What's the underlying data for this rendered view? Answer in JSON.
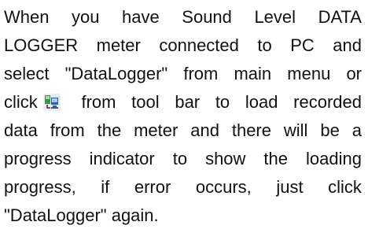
{
  "paragraph": {
    "line1": [
      "When",
      "you",
      "have",
      "Sound",
      "Level",
      "DATA"
    ],
    "line2": [
      "LOGGER",
      "meter",
      "connected",
      "to",
      "PC",
      "and"
    ],
    "line3": [
      "select",
      "\"DataLogger\"",
      "from",
      "main",
      "menu",
      "or"
    ],
    "line4": {
      "before_icon": "click",
      "icon": "datalogger-toolbar-icon",
      "after_icon": [
        "from",
        "tool",
        "bar",
        "to",
        "load",
        "recorded"
      ]
    },
    "line5": [
      "data",
      "from",
      "the",
      "meter",
      "and",
      "there",
      "will",
      "be",
      "a"
    ],
    "line6": [
      "progress",
      "indicator",
      "to",
      "show",
      "the",
      "loading"
    ],
    "line7": [
      "progress,",
      "if",
      "error",
      "occurs,",
      "just",
      "click"
    ],
    "line8": "\"DataLogger\" again."
  },
  "colors": {
    "text": "#111111",
    "icon_green": "#2e9e3a",
    "icon_blue": "#2a5fb8"
  }
}
